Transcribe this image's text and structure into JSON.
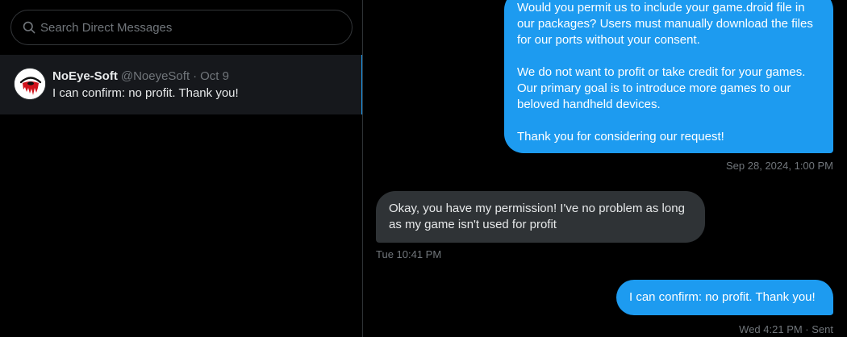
{
  "search": {
    "placeholder": "Search Direct Messages",
    "icon": "search-icon"
  },
  "conversations": [
    {
      "name": "NoEye-Soft",
      "handle": "@NoeyeSoft",
      "separator": "·",
      "date": "Oct 9",
      "preview": "I can confirm: no profit. Thank you!",
      "avatar_icon": "bleeding-eye-icon",
      "selected": true
    }
  ],
  "messages": [
    {
      "direction": "outgoing",
      "paragraphs": [
        "Would you permit us to include your game.droid file in our packages? Users must manually download the files for our ports without your consent.",
        "We do not want to profit or take credit for your games. Our primary goal is to introduce more games to our beloved handheld devices.",
        "Thank you for considering our request!"
      ],
      "timestamp": "Sep 28, 2024, 1:00 PM"
    },
    {
      "direction": "incoming",
      "text": "Okay, you have my permission! I've no problem as long as my game isn't used for profit",
      "timestamp": "Tue 10:41 PM"
    },
    {
      "direction": "outgoing",
      "text": "I can confirm: no profit. Thank you!",
      "timestamp": "Wed 4:21 PM · Sent"
    }
  ],
  "colors": {
    "background": "#000000",
    "accent": "#1d9bf0",
    "incoming_bubble": "#2f3336",
    "selected_row": "#16181c",
    "muted_text": "#71767b",
    "primary_text": "#e7e9ea"
  }
}
